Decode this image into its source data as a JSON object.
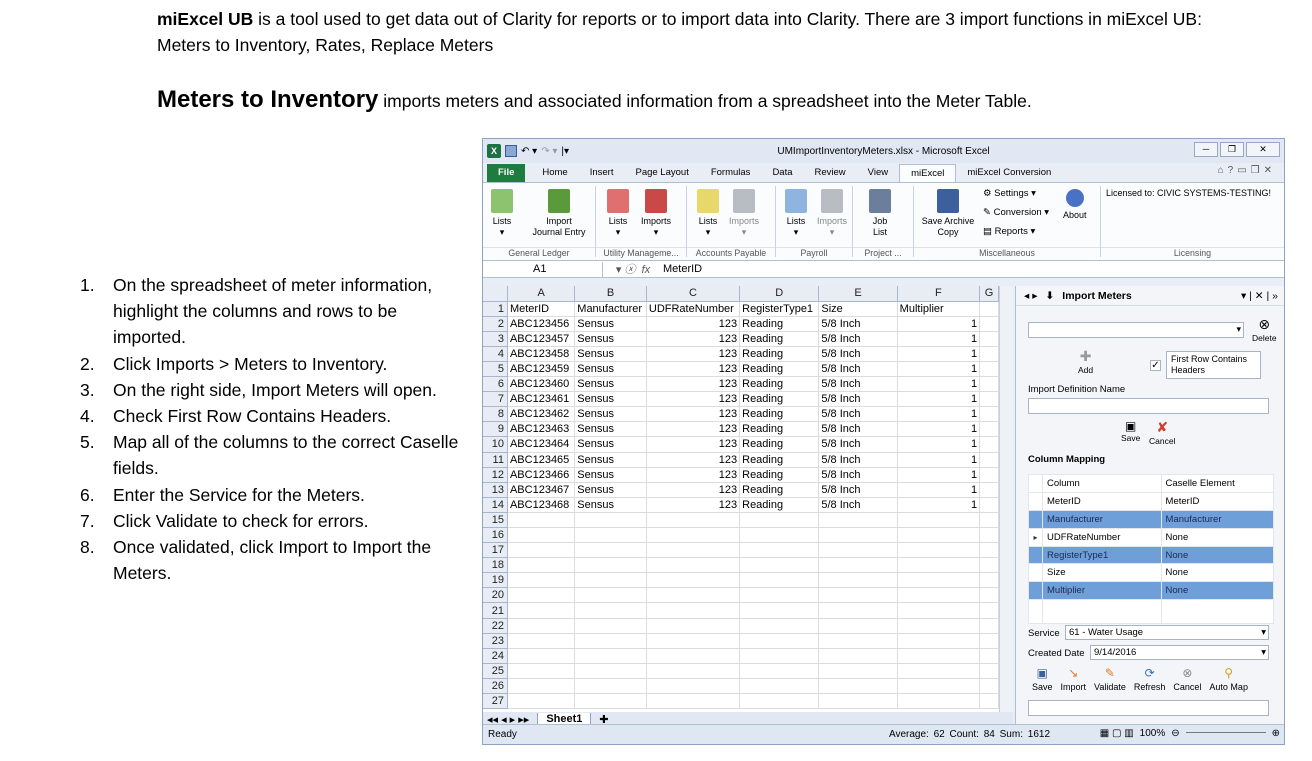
{
  "intro": {
    "tool_name": "miExcel UB",
    "text": " is a tool used to get data out of Clarity for reports or to import data into Clarity.   There are 3 import functions in miExcel UB:   Meters to Inventory,  Rates,  Replace Meters"
  },
  "section": {
    "title": "Meters to Inventory",
    "text": " imports meters and associated information from a spreadsheet into the Meter Table."
  },
  "steps": [
    {
      "n": "1.",
      "text": "On the spreadsheet of meter information,  highlight the columns and rows to be imported."
    },
    {
      "n": "2.",
      "text": "Click Imports > Meters to Inventory."
    },
    {
      "n": "3.",
      "text": "On the right side, Import Meters will open."
    },
    {
      "n": "4.",
      "text": "Check First Row Contains Headers."
    },
    {
      "n": "5.",
      "text": "Map all of  the columns to the correct Caselle fields."
    },
    {
      "n": "6.",
      "text": "Enter the Service for the Meters."
    },
    {
      "n": "7.",
      "text": "Click Validate to check for errors."
    },
    {
      "n": "8.",
      "text": "Once validated, click Import to Import the Meters."
    }
  ],
  "excel": {
    "window_title": "UMImportInventoryMeters.xlsx - Microsoft Excel",
    "tabs": [
      "File",
      "Home",
      "Insert",
      "Page Layout",
      "Formulas",
      "Data",
      "Review",
      "View",
      "miExcel",
      "miExcel Conversion"
    ],
    "ribbon": {
      "lists_gl": "Lists",
      "import_journal": "Import",
      "import_journal2": "Journal Entry",
      "group_gl": "General Ledger",
      "lists_um": "Lists",
      "imports_um": "Imports",
      "group_um": "Utility Manageme...",
      "lists_ap": "Lists",
      "imports_ap": "Imports",
      "group_ap": "Accounts Payable",
      "lists_pr": "Lists",
      "imports_pr": "Imports",
      "group_pr": "Payroll",
      "job_list": "Job",
      "job_list2": "List",
      "group_proj": "Project ...",
      "save_archive": "Save Archive",
      "save_archive2": "Copy",
      "settings": "Settings",
      "conversion": "Conversion",
      "reports": "Reports",
      "about": "About",
      "group_misc": "Miscellaneous",
      "licensed": "Licensed to: CIVIC SYSTEMS-TESTING!",
      "group_lic": "Licensing"
    },
    "name_box": "A1",
    "formula": "MeterID",
    "columns": [
      "A",
      "B",
      "C",
      "D",
      "E",
      "F",
      "G"
    ],
    "headers": [
      "MeterID",
      "Manufacturer",
      "UDFRateNumber",
      "RegisterType1",
      "Size",
      "Multiplier"
    ],
    "rows": [
      [
        "ABC123456",
        "Sensus",
        "123",
        "Reading",
        "5/8 Inch",
        "1"
      ],
      [
        "ABC123457",
        "Sensus",
        "123",
        "Reading",
        "5/8 Inch",
        "1"
      ],
      [
        "ABC123458",
        "Sensus",
        "123",
        "Reading",
        "5/8 Inch",
        "1"
      ],
      [
        "ABC123459",
        "Sensus",
        "123",
        "Reading",
        "5/8 Inch",
        "1"
      ],
      [
        "ABC123460",
        "Sensus",
        "123",
        "Reading",
        "5/8 Inch",
        "1"
      ],
      [
        "ABC123461",
        "Sensus",
        "123",
        "Reading",
        "5/8 Inch",
        "1"
      ],
      [
        "ABC123462",
        "Sensus",
        "123",
        "Reading",
        "5/8 Inch",
        "1"
      ],
      [
        "ABC123463",
        "Sensus",
        "123",
        "Reading",
        "5/8 Inch",
        "1"
      ],
      [
        "ABC123464",
        "Sensus",
        "123",
        "Reading",
        "5/8 Inch",
        "1"
      ],
      [
        "ABC123465",
        "Sensus",
        "123",
        "Reading",
        "5/8 Inch",
        "1"
      ],
      [
        "ABC123466",
        "Sensus",
        "123",
        "Reading",
        "5/8 Inch",
        "1"
      ],
      [
        "ABC123467",
        "Sensus",
        "123",
        "Reading",
        "5/8 Inch",
        "1"
      ],
      [
        "ABC123468",
        "Sensus",
        "123",
        "Reading",
        "5/8 Inch",
        "1"
      ]
    ],
    "total_rows": 27,
    "sheet_tab": "Sheet1",
    "status_ready": "Ready",
    "status_stats": "Average: 62    Count: 84    Sum: 1612",
    "zoom": "100%"
  },
  "import_pane": {
    "title": "Import Meters",
    "delete": "Delete",
    "add": "Add",
    "first_row_label": "First Row Contains Headers",
    "first_row_checked": true,
    "def_name_label": "Import Definition Name",
    "save": "Save",
    "cancel": "Cancel",
    "column_mapping": "Column Mapping",
    "mapping_header": [
      "Column",
      "Caselle Element"
    ],
    "mapping": [
      {
        "column": "MeterID",
        "element": "MeterID",
        "selected": false
      },
      {
        "column": "Manufacturer",
        "element": "Manufacturer",
        "selected": true
      },
      {
        "column": "UDFRateNumber",
        "element": "None",
        "selected": false
      },
      {
        "column": "RegisterType1",
        "element": "None",
        "selected": true
      },
      {
        "column": "Size",
        "element": "None",
        "selected": false
      },
      {
        "column": "Multiplier",
        "element": "None",
        "selected": true
      }
    ],
    "service_label": "Service",
    "service_value": "61 - Water Usage",
    "created_label": "Created Date",
    "created_value": "9/14/2016",
    "buttons": [
      "Save",
      "Import",
      "Validate",
      "Refresh",
      "Cancel",
      "Auto Map"
    ]
  }
}
